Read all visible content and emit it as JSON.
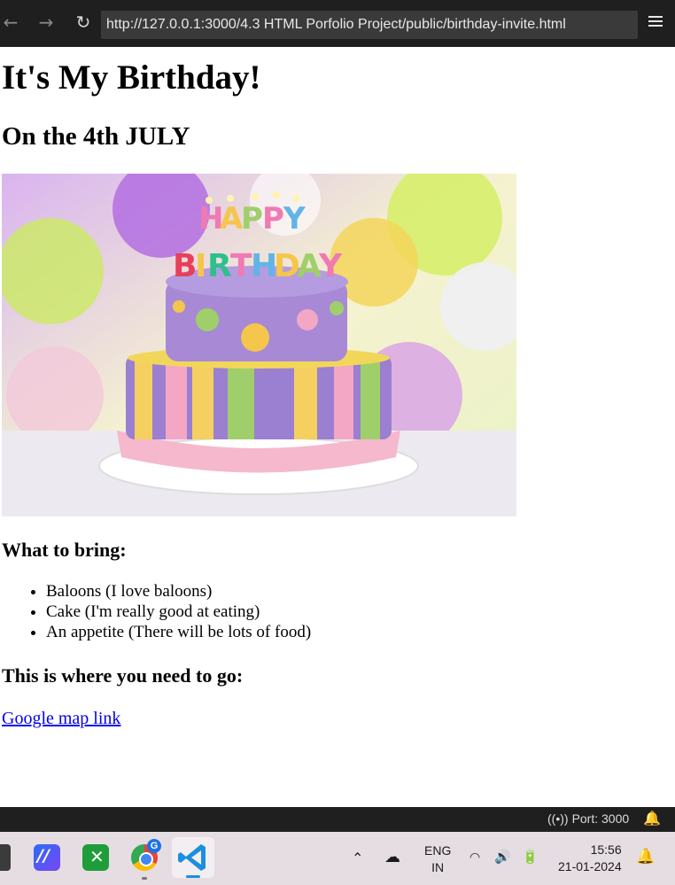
{
  "browser": {
    "url": "http://127.0.0.1:3000/4.3 HTML Porfolio Project/public/birthday-invite.html"
  },
  "page": {
    "heading": "It's My Birthday!",
    "subheading": "On the 4th JULY",
    "image_alt": "Birthday cake",
    "bring_heading": "What to bring:",
    "bring_items": [
      "Baloons (I love baloons)",
      "Cake (I'm really good at eating)",
      "An appetite (There will be lots of food)"
    ],
    "location_heading": "This is where you need to go:",
    "map_link": "Google map link"
  },
  "statusbar": {
    "port": "Port: 3000"
  },
  "taskbar": {
    "lang_line1": "ENG",
    "lang_line2": "IN",
    "time": "15:56",
    "date": "21-01-2024",
    "chrome_badge": "G"
  },
  "colors": {
    "link": "#0000ee",
    "toolbar_bg": "#1f1f1f",
    "taskbar_bg": "#e6dde2"
  }
}
